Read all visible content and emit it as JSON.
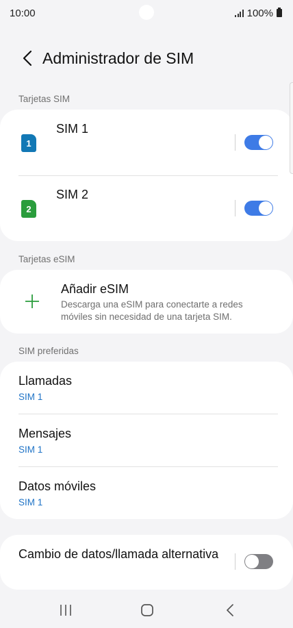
{
  "status_bar": {
    "time": "10:00",
    "battery": "100%"
  },
  "app_bar": {
    "title": "Administrador de SIM",
    "back_icon": "chevron-left-icon"
  },
  "sections": {
    "sim_cards": "Tarjetas SIM",
    "esim_cards": "Tarjetas eSIM",
    "preferred": "SIM preferidas"
  },
  "sim_cards": [
    {
      "badge": "1",
      "name": "SIM 1",
      "enabled": true,
      "color": "#1278b5"
    },
    {
      "badge": "2",
      "name": "SIM 2",
      "enabled": true,
      "color": "#2a9d3c"
    }
  ],
  "esim": {
    "title": "Añadir eSIM",
    "description": "Descarga una eSIM para conectarte a redes móviles sin necesidad de una tarjeta SIM.",
    "icon": "plus-icon",
    "icon_color": "#2a9d3c"
  },
  "preferred": [
    {
      "title": "Llamadas",
      "value": "SIM 1"
    },
    {
      "title": "Mensajes",
      "value": "SIM 1"
    },
    {
      "title": "Datos móviles",
      "value": "SIM 1"
    }
  ],
  "alternate": {
    "title": "Cambio de datos/llamada alternativa",
    "enabled": false
  },
  "colors": {
    "accent": "#3e7be6",
    "link": "#1f73c6",
    "background": "#f4f4f6"
  },
  "nav_bar": {
    "recents_icon": "recents-icon",
    "home_icon": "home-icon",
    "back_icon": "back-icon"
  }
}
